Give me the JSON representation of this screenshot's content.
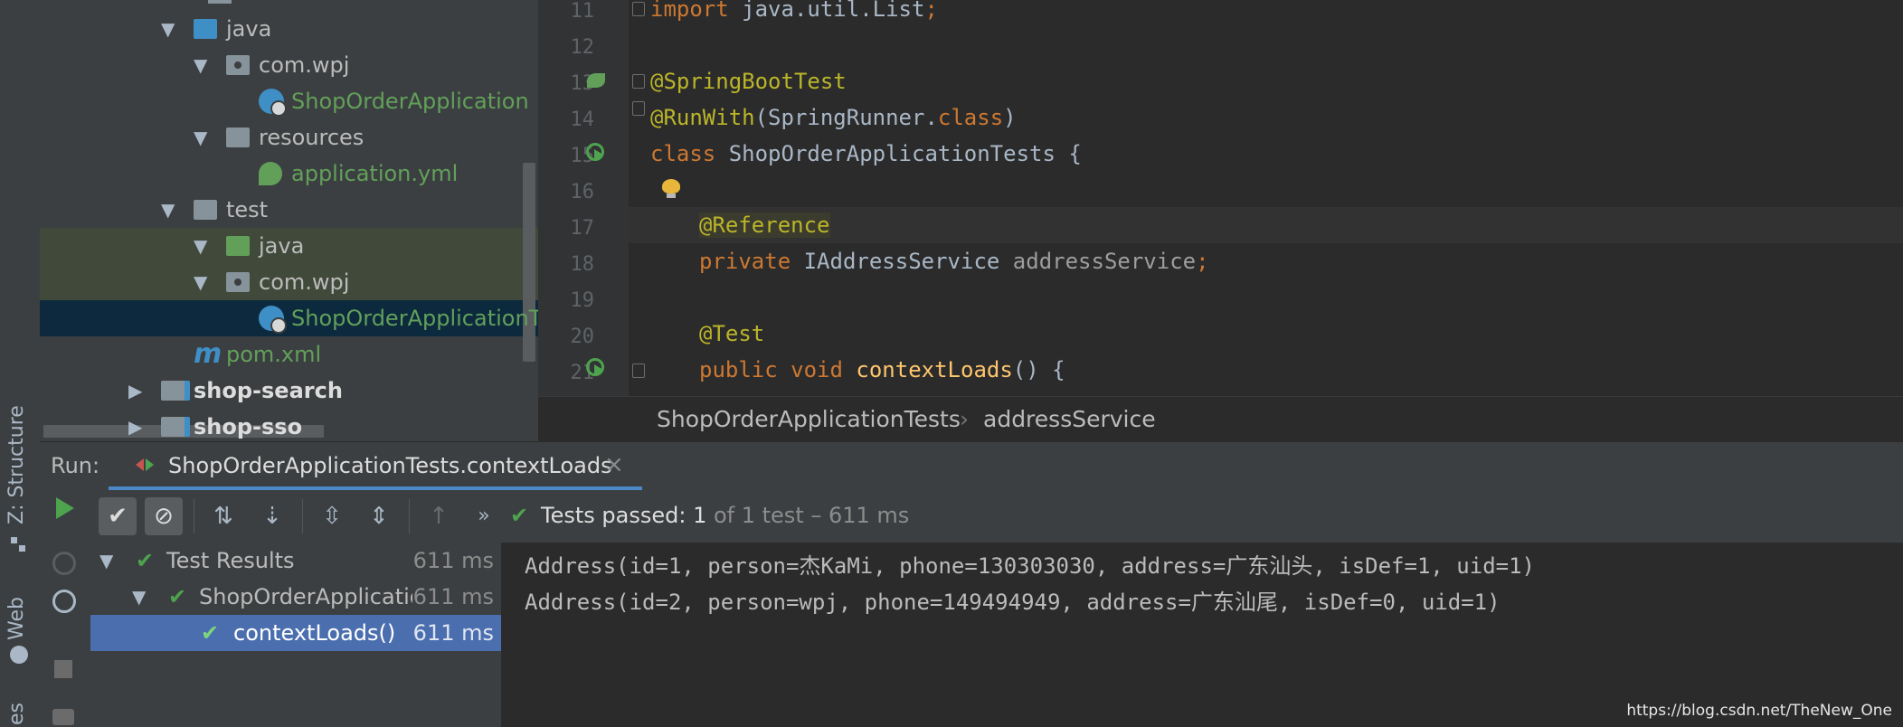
{
  "left_strip": {
    "structure_label": "Z: Structure",
    "web_label": "Web",
    "partial_label": "es"
  },
  "project_tree": [
    {
      "depth": 2,
      "expanded": true,
      "icon": "folder-blue-icon",
      "label": "java"
    },
    {
      "depth": 3,
      "expanded": true,
      "icon": "package-icon",
      "label": "com.wpj"
    },
    {
      "depth": 4,
      "expanded": null,
      "icon": "spring-boot-class-icon",
      "label": "ShopOrderApplication",
      "color": "#62a05a"
    },
    {
      "depth": 3,
      "expanded": true,
      "icon": "resources-folder-icon",
      "label": "resources"
    },
    {
      "depth": 4,
      "expanded": null,
      "icon": "yml-file-icon",
      "label": "application.yml",
      "color": "#62a05a"
    },
    {
      "depth": 2,
      "expanded": true,
      "icon": "folder-icon",
      "label": "test"
    },
    {
      "depth": 3,
      "expanded": true,
      "icon": "folder-green-icon",
      "label": "java"
    },
    {
      "depth": 3,
      "expanded": true,
      "icon": "package-icon",
      "label": "com.wpj"
    },
    {
      "depth": 4,
      "expanded": null,
      "icon": "test-class-icon",
      "label": "ShopOrderApplicationTests",
      "color": "#62a05a"
    },
    {
      "depth": 2,
      "expanded": null,
      "icon": "maven-icon",
      "label": "pom.xml",
      "color": "#62a05a"
    },
    {
      "depth": 1,
      "expanded": false,
      "icon": "module-icon",
      "label": "shop-search",
      "bold": true
    },
    {
      "depth": 1,
      "expanded": false,
      "icon": "module-icon",
      "label": "shop-sso",
      "bold": true
    }
  ],
  "editor": {
    "line_numbers": [
      "11",
      "12",
      "13",
      "14",
      "15",
      "16",
      "17",
      "18",
      "19",
      "20",
      "21"
    ],
    "line11": {
      "kw": "import",
      "rest": " java.util.List",
      "semi": ";"
    },
    "line13": {
      "ann": "@SpringBootTest"
    },
    "line14": {
      "ann": "@RunWith",
      "open": "(",
      "cls": "SpringRunner.",
      "kw": "class",
      "close": ")"
    },
    "line15": {
      "kw": "class",
      "rest": " ShopOrderApplicationTests {"
    },
    "line17": {
      "ann": "@Reference"
    },
    "line18": {
      "kw": "private",
      "type": " IAddressService ",
      "field": "addressService",
      "semi": ";"
    },
    "line20": {
      "ann": "@Test"
    },
    "line21": {
      "kw1": "public",
      "kw2": " void ",
      "fn": "contextLoads",
      "rest": "() {"
    }
  },
  "breadcrumb": {
    "class_name": "ShopOrderApplicationTests",
    "separator": "›",
    "member": "addressService"
  },
  "run_panel": {
    "run_label": "Run:",
    "tab_label": "ShopOrderApplicationTests.contextLoads",
    "close_glyph": "×",
    "status_prefix": "Tests passed: ",
    "status_count": "1",
    "status_suffix": " of 1 test – 611 ms",
    "more_glyph": "»"
  },
  "test_tree": [
    {
      "label": "Test Results",
      "time": "611 ms",
      "depth": 0,
      "selected": false
    },
    {
      "label": "ShopOrderApplicatio",
      "time": "611 ms",
      "depth": 1,
      "selected": false
    },
    {
      "label": "contextLoads()",
      "time": "611 ms",
      "depth": 2,
      "selected": true
    }
  ],
  "console": [
    "Address(id=1, person=杰KaMi, phone=130303030, address=广东汕头, isDef=1, uid=1)",
    "Address(id=2, person=wpj, phone=149494949, address=广东汕尾, isDef=0, uid=1)"
  ],
  "watermark": "https://blog.csdn.net/TheNew_One",
  "colors": {
    "accent_blue": "#4a88c7",
    "pass_green": "#4ea34e",
    "selection": "#4b6eaf"
  }
}
